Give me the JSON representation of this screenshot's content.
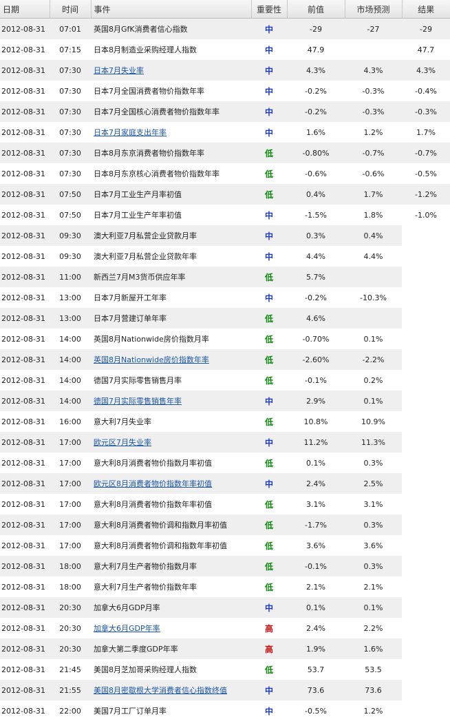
{
  "headers": {
    "date": "日期",
    "time": "时间",
    "event": "事件",
    "importance": "重要性",
    "previous": "前值",
    "forecast": "市场预测",
    "result": "结果"
  },
  "colors": {
    "importance_high": "#cc1111",
    "importance_mid": "#1a37c8",
    "importance_low": "#0a8a0a",
    "link": "#1a55a8",
    "row_band": "#efefef"
  },
  "rows": [
    {
      "date": "2012-08-31",
      "time": "07:01",
      "event": "英国8月GfK消费者信心指数",
      "link": false,
      "importance": "中",
      "level": "mid",
      "previous": "-29",
      "forecast": "-27",
      "result": "-29"
    },
    {
      "date": "2012-08-31",
      "time": "07:15",
      "event": "日本8月制造业采购经理人指数",
      "link": false,
      "importance": "中",
      "level": "mid",
      "previous": "47.9",
      "forecast": "",
      "result": "47.7"
    },
    {
      "date": "2012-08-31",
      "time": "07:30",
      "event": "日本7月失业率",
      "link": true,
      "importance": "中",
      "level": "mid",
      "previous": "4.3%",
      "forecast": "4.3%",
      "result": "4.3%"
    },
    {
      "date": "2012-08-31",
      "time": "07:30",
      "event": "日本7月全国消费者物价指数年率",
      "link": false,
      "importance": "中",
      "level": "mid",
      "previous": "-0.2%",
      "forecast": "-0.3%",
      "result": "-0.4%"
    },
    {
      "date": "2012-08-31",
      "time": "07:30",
      "event": "日本7月全国核心消费者物价指数年率",
      "link": false,
      "importance": "中",
      "level": "mid",
      "previous": "-0.2%",
      "forecast": "-0.3%",
      "result": "-0.3%"
    },
    {
      "date": "2012-08-31",
      "time": "07:30",
      "event": "日本7月家庭支出年率",
      "link": true,
      "importance": "中",
      "level": "mid",
      "previous": "1.6%",
      "forecast": "1.2%",
      "result": "1.7%"
    },
    {
      "date": "2012-08-31",
      "time": "07:30",
      "event": "日本8月东京消费者物价指数年率",
      "link": false,
      "importance": "低",
      "level": "low",
      "previous": "-0.80%",
      "forecast": "-0.7%",
      "result": "-0.7%"
    },
    {
      "date": "2012-08-31",
      "time": "07:30",
      "event": "日本8月东京核心消费者物价指数年率",
      "link": false,
      "importance": "低",
      "level": "low",
      "previous": "-0.6%",
      "forecast": "-0.6%",
      "result": "-0.5%"
    },
    {
      "date": "2012-08-31",
      "time": "07:50",
      "event": "日本7月工业生产月率初值",
      "link": false,
      "importance": "低",
      "level": "low",
      "previous": "0.4%",
      "forecast": "1.7%",
      "result": "-1.2%"
    },
    {
      "date": "2012-08-31",
      "time": "07:50",
      "event": "日本7月工业生产年率初值",
      "link": false,
      "importance": "中",
      "level": "mid",
      "previous": "-1.5%",
      "forecast": "1.8%",
      "result": "-1.0%"
    },
    {
      "date": "2012-08-31",
      "time": "09:30",
      "event": "澳大利亚7月私营企业贷款月率",
      "link": false,
      "importance": "中",
      "level": "mid",
      "previous": "0.3%",
      "forecast": "0.4%",
      "result": ""
    },
    {
      "date": "2012-08-31",
      "time": "09:30",
      "event": "澳大利亚7月私营企业贷款年率",
      "link": false,
      "importance": "中",
      "level": "mid",
      "previous": "4.4%",
      "forecast": "4.4%",
      "result": ""
    },
    {
      "date": "2012-08-31",
      "time": "11:00",
      "event": "新西兰7月M3货币供应年率",
      "link": false,
      "importance": "低",
      "level": "low",
      "previous": "5.7%",
      "forecast": "",
      "result": ""
    },
    {
      "date": "2012-08-31",
      "time": "13:00",
      "event": "日本7月新屋开工年率",
      "link": false,
      "importance": "中",
      "level": "mid",
      "previous": "-0.2%",
      "forecast": "-10.3%",
      "result": ""
    },
    {
      "date": "2012-08-31",
      "time": "13:00",
      "event": "日本7月营建订单年率",
      "link": false,
      "importance": "低",
      "level": "low",
      "previous": "4.6%",
      "forecast": "",
      "result": ""
    },
    {
      "date": "2012-08-31",
      "time": "14:00",
      "event": "英国8月Nationwide房价指数月率",
      "link": false,
      "importance": "低",
      "level": "low",
      "previous": "-0.70%",
      "forecast": "0.1%",
      "result": ""
    },
    {
      "date": "2012-08-31",
      "time": "14:00",
      "event": "英国8月Nationwide房价指数年率",
      "link": true,
      "importance": "低",
      "level": "low",
      "previous": "-2.60%",
      "forecast": "-2.2%",
      "result": ""
    },
    {
      "date": "2012-08-31",
      "time": "14:00",
      "event": "德国7月实际零售销售月率",
      "link": false,
      "importance": "低",
      "level": "low",
      "previous": "-0.1%",
      "forecast": "0.2%",
      "result": ""
    },
    {
      "date": "2012-08-31",
      "time": "14:00",
      "event": "德国7月实际零售销售年率",
      "link": true,
      "importance": "中",
      "level": "mid",
      "previous": "2.9%",
      "forecast": "0.1%",
      "result": ""
    },
    {
      "date": "2012-08-31",
      "time": "16:00",
      "event": "意大利7月失业率",
      "link": false,
      "importance": "低",
      "level": "low",
      "previous": "10.8%",
      "forecast": "10.9%",
      "result": ""
    },
    {
      "date": "2012-08-31",
      "time": "17:00",
      "event": "欧元区7月失业率",
      "link": true,
      "importance": "中",
      "level": "mid",
      "previous": "11.2%",
      "forecast": "11.3%",
      "result": ""
    },
    {
      "date": "2012-08-31",
      "time": "17:00",
      "event": "意大利8月消费者物价指数月率初值",
      "link": false,
      "importance": "低",
      "level": "low",
      "previous": "0.1%",
      "forecast": "0.3%",
      "result": ""
    },
    {
      "date": "2012-08-31",
      "time": "17:00",
      "event": "欧元区8月消费者物价指数年率初值",
      "link": true,
      "importance": "中",
      "level": "mid",
      "previous": "2.4%",
      "forecast": "2.5%",
      "result": ""
    },
    {
      "date": "2012-08-31",
      "time": "17:00",
      "event": "意大利8月消费者物价指数年率初值",
      "link": false,
      "importance": "低",
      "level": "low",
      "previous": "3.1%",
      "forecast": "3.1%",
      "result": ""
    },
    {
      "date": "2012-08-31",
      "time": "17:00",
      "event": "意大利8月消费者物价调和指数月率初值",
      "link": false,
      "importance": "低",
      "level": "low",
      "previous": "-1.7%",
      "forecast": "0.3%",
      "result": ""
    },
    {
      "date": "2012-08-31",
      "time": "17:00",
      "event": "意大利8月消费者物价调和指数年率初值",
      "link": false,
      "importance": "低",
      "level": "low",
      "previous": "3.6%",
      "forecast": "3.6%",
      "result": ""
    },
    {
      "date": "2012-08-31",
      "time": "18:00",
      "event": "意大利7月生产者物价指数月率",
      "link": false,
      "importance": "低",
      "level": "low",
      "previous": "-0.1%",
      "forecast": "0.3%",
      "result": ""
    },
    {
      "date": "2012-08-31",
      "time": "18:00",
      "event": "意大利7月生产者物价指数年率",
      "link": false,
      "importance": "低",
      "level": "low",
      "previous": "2.1%",
      "forecast": "2.1%",
      "result": ""
    },
    {
      "date": "2012-08-31",
      "time": "20:30",
      "event": "加拿大6月GDP月率",
      "link": false,
      "importance": "中",
      "level": "mid",
      "previous": "0.1%",
      "forecast": "0.1%",
      "result": ""
    },
    {
      "date": "2012-08-31",
      "time": "20:30",
      "event": "加拿大6月GDP年率",
      "link": true,
      "importance": "高",
      "level": "high",
      "previous": "2.4%",
      "forecast": "2.2%",
      "result": ""
    },
    {
      "date": "2012-08-31",
      "time": "20:30",
      "event": "加拿大第二季度GDP年率",
      "link": false,
      "importance": "高",
      "level": "high",
      "previous": "1.9%",
      "forecast": "1.6%",
      "result": ""
    },
    {
      "date": "2012-08-31",
      "time": "21:45",
      "event": "美国8月芝加哥采购经理人指数",
      "link": false,
      "importance": "低",
      "level": "low",
      "previous": "53.7",
      "forecast": "53.5",
      "result": ""
    },
    {
      "date": "2012-08-31",
      "time": "21:55",
      "event": "美国8月密歇根大学消费者信心指数终值",
      "link": true,
      "importance": "中",
      "level": "mid",
      "previous": "73.6",
      "forecast": "73.6",
      "result": ""
    },
    {
      "date": "2012-08-31",
      "time": "22:00",
      "event": "美国7月工厂订单月率",
      "link": false,
      "importance": "中",
      "level": "mid",
      "previous": "-0.5%",
      "forecast": "1.2%",
      "result": ""
    }
  ]
}
